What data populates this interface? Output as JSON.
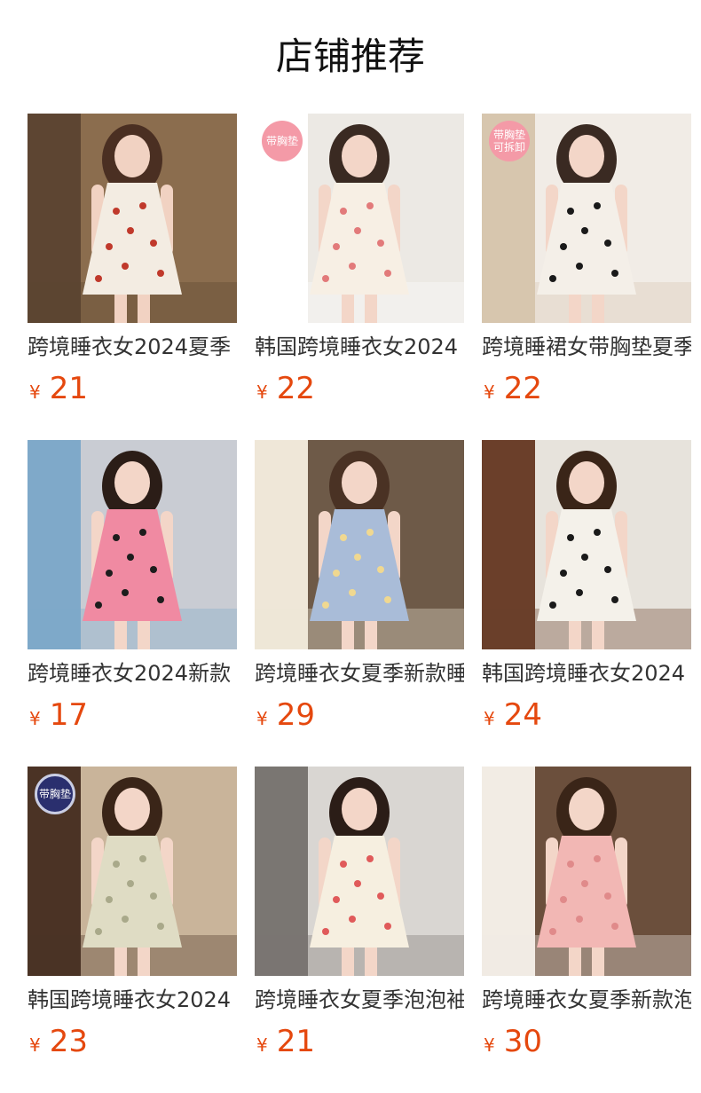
{
  "page": {
    "title": "店铺推荐"
  },
  "products": [
    {
      "name": "跨境睡衣女2024夏季",
      "currency": "¥",
      "price": "21",
      "badge": "",
      "badge_sub": "",
      "colors": {
        "bg": "#8b6d4e",
        "bg2": "#5d4532",
        "dress": "#f3ece2",
        "pattern": "#c0392b",
        "skin": "#f1d2c2",
        "hair": "#4a2f22"
      }
    },
    {
      "name": "韩国跨境睡衣女2024",
      "currency": "¥",
      "price": "22",
      "badge": "带胸垫",
      "badge_sub": "",
      "colors": {
        "bg": "#ece9e4",
        "bg2": "#ffffff",
        "dress": "#f7efe4",
        "pattern": "#e27a7a",
        "skin": "#f3d6c8",
        "hair": "#3a2a22"
      }
    },
    {
      "name": "跨境睡裙女带胸垫夏季",
      "currency": "¥",
      "price": "22",
      "badge": "带胸垫",
      "badge_sub": "可拆卸",
      "colors": {
        "bg": "#f1ece6",
        "bg2": "#d7c6ae",
        "dress": "#f4efe8",
        "pattern": "#1a1a1a",
        "skin": "#f3d6c8",
        "hair": "#3a2a22"
      }
    },
    {
      "name": "跨境睡衣女2024新款",
      "currency": "¥",
      "price": "17",
      "badge": "",
      "badge_sub": "",
      "colors": {
        "bg": "#c9ccd3",
        "bg2": "#7fa9c9",
        "dress": "#f08aa2",
        "pattern": "#1d1d1d",
        "skin": "#f3d6c8",
        "hair": "#2b1d17"
      }
    },
    {
      "name": "跨境睡衣女夏季新款睡",
      "currency": "¥",
      "price": "29",
      "badge": "",
      "badge_sub": "",
      "colors": {
        "bg": "#6e5a48",
        "bg2": "#efe7d8",
        "dress": "#a9bcd8",
        "pattern": "#f0d890",
        "skin": "#f3d6c8",
        "hair": "#4a3224"
      }
    },
    {
      "name": "韩国跨境睡衣女2024",
      "currency": "¥",
      "price": "24",
      "badge": "",
      "badge_sub": "",
      "colors": {
        "bg": "#e7e3dc",
        "bg2": "#6b3f2a",
        "dress": "#f4f1ea",
        "pattern": "#1a1a1a",
        "skin": "#f3d6c8",
        "hair": "#3a2518"
      }
    },
    {
      "name": "韩国跨境睡衣女2024",
      "currency": "¥",
      "price": "23",
      "badge": "带胸垫",
      "badge_sub": "",
      "colors": {
        "bg": "#c9b49a",
        "bg2": "#4b3325",
        "dress": "#dfdcc4",
        "pattern": "#a9a98a",
        "skin": "#f3d6c8",
        "hair": "#3a2518"
      }
    },
    {
      "name": "跨境睡衣女夏季泡泡袖",
      "currency": "¥",
      "price": "21",
      "badge": "",
      "badge_sub": "",
      "colors": {
        "bg": "#d9d6d2",
        "bg2": "#7a7672",
        "dress": "#f6efe0",
        "pattern": "#e05a5a",
        "skin": "#f3d6c8",
        "hair": "#2b1d17"
      }
    },
    {
      "name": "跨境睡衣女夏季新款泡",
      "currency": "¥",
      "price": "30",
      "badge": "",
      "badge_sub": "",
      "colors": {
        "bg": "#6b4f3c",
        "bg2": "#f2ece4",
        "dress": "#f2b7b4",
        "pattern": "#e08a8a",
        "skin": "#f3d6c8",
        "hair": "#3a2518"
      }
    }
  ]
}
